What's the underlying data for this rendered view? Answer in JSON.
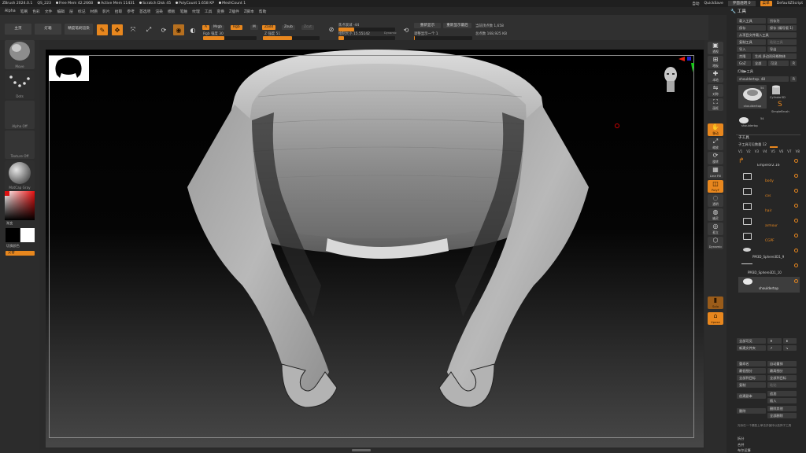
{
  "titlebar": {
    "app": "ZBrush 2024.0.1",
    "file": "QS_223",
    "stats": [
      "Free Mem 42.266B",
      "Active Mem 11431",
      "Scratch Disk 45",
      "PolyCount 1.658 KP",
      "MeshCount 1"
    ],
    "quicksave": "QuickSave",
    "see_through": "界面透明 0",
    "menus_label": "菜单",
    "script": "DefaultZScript",
    "crumb": "自动"
  },
  "menubar": [
    "Alpha",
    "笔刷",
    "色彩",
    "文件",
    "编辑",
    "层",
    "标记",
    "材质",
    "影片",
    "拾取",
    "参考",
    "首选项",
    "渲染",
    "模板",
    "笔触",
    "纹理",
    "工具",
    "变换",
    "Z插件",
    "Z脚本",
    "帮助"
  ],
  "toolbar": {
    "home": "主页",
    "lightbox": "灯箱",
    "lightbox_brush": "精度笔刷渲染",
    "edit": "Edit",
    "draw": "Draw",
    "move": "Move",
    "scale": "Scale",
    "rotate": "Rotate",
    "a_chip": "A",
    "mrgb": "Mrgb",
    "rgb": "Rgb",
    "m": "M",
    "rgb_intensity": "Rgb 强度 30",
    "zadd": "Zadd",
    "zsub": "Zsub",
    "zcut": "Zcut",
    "z_intensity": "Z 强度 51",
    "focal_shift": "焦点衰减 -44",
    "draw_size": "绘制大小 15.55142",
    "dynamic": "Dynamic",
    "redisplay": "重新显示",
    "reset_last": "重新显示最后",
    "update_one": "调整显示一个 1",
    "active_points": "当前顶点数 1,658",
    "total_points": "总点数 168,925 KB"
  },
  "leftshelf": {
    "brush": "Move",
    "stroke": "Dots",
    "alpha": "Alpha Off",
    "texture": "Texture Off",
    "material": "MatCap Gray",
    "gradient": "渐变",
    "switch_color": "切换颜色",
    "alternate": "交替"
  },
  "rightshelf": [
    "透视",
    "地板",
    "本地",
    "对称",
    "画框",
    "移动",
    "缩放",
    "旋转",
    "Line Fill",
    "PolyF",
    "透明",
    "幽灵",
    "孤立",
    "Dynamic",
    "Solo",
    "Xpose"
  ],
  "toolpanel": {
    "header": "工具",
    "load_tool": "载入工具",
    "save_as": "另存为",
    "copy": "保存",
    "save_version": "保存 (编号版 1)",
    "import_proj": "从项目文件载入工具",
    "copy_tool": "复制工具",
    "paste_tool": "粘贴工具",
    "import": "导入",
    "export": "导出",
    "clone": "克隆",
    "make_polymesh": "生成 多边形网格物体",
    "goz": "GoZ",
    "all": "全部",
    "visible": "可见",
    "r": "R",
    "lightbox_tools": "灯箱▶工具",
    "current_tool": "shouldertop. 48",
    "thumb_count": "54",
    "thumb1": "shouldertop",
    "thumb2": "Cylinder3D",
    "thumb3": "SimpleBrush",
    "thumb4": "shouldertop",
    "thumb4_count": "54",
    "subtool_header": "子工具",
    "subtool_count": "子工具可见数量 12",
    "vlist": [
      "V1",
      "V2",
      "V3",
      "V4",
      "V5",
      "V6",
      "V7",
      "V8"
    ],
    "subtools": [
      {
        "name": "Emperor2.16",
        "type": "folder-header"
      },
      {
        "name": "body",
        "type": "folder"
      },
      {
        "name": "cos",
        "type": "folder"
      },
      {
        "name": "hair",
        "type": "folder"
      },
      {
        "name": "armour",
        "type": "folder"
      },
      {
        "name": "CGPF",
        "type": "folder"
      },
      {
        "name": "PM3D_Sphere3D1_9",
        "type": "mesh"
      },
      {
        "name": "PM3D_Sphere3D1_10",
        "type": "mesh"
      },
      {
        "name": "shouldertop",
        "type": "mesh"
      }
    ],
    "listall": "全部可见",
    "newfolder": "新建文件夹",
    "rename": "重命名",
    "autoreorder": "自动重排",
    "all_low": "最低细分",
    "all_high": "最高细分",
    "all_to_target": "全部到目标",
    "all_to_target2": "全部到目标",
    "dup": "复制",
    "merge": "粘贴",
    "create_clone": "创建副本",
    "append": "追加",
    "insert": "插入",
    "delete": "删除",
    "del_other": "删除其他",
    "del_all": "全部删除",
    "hint": "光标在一个模型上单击并保持以选择子工具",
    "split": "拆分",
    "merge2": "合并",
    "boolean": "布尔运算"
  },
  "colors": {
    "accent": "#e8871e",
    "panel": "#262626",
    "button": "#3b3b3b"
  }
}
